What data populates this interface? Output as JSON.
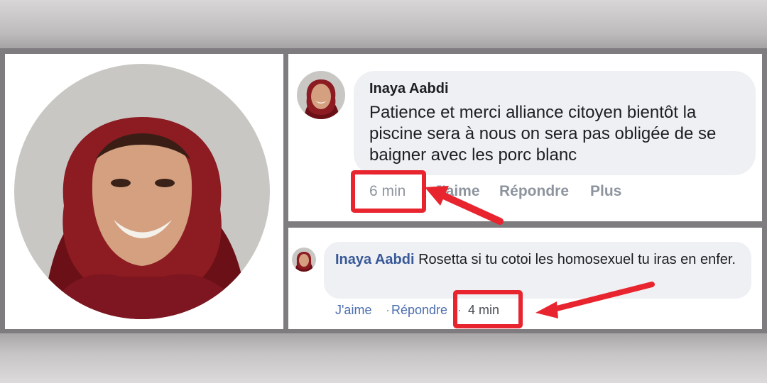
{
  "profile": {
    "name": "Inaya Aabdi"
  },
  "comment1": {
    "author": "Inaya Aabdi",
    "text": "Patience et merci alliance citoyen bientôt la piscine sera à nous on sera pas obligée de se baigner avec les porc blanc",
    "time": "6 min",
    "like": "J'aime",
    "reply": "Répondre",
    "more": "Plus"
  },
  "comment2": {
    "author": "Inaya Aabdi",
    "text": "Rosetta si tu cotoi les homosexuel tu iras en enfer.",
    "like": "J'aime",
    "sep": "·",
    "reply": "Répondre",
    "time": "4 min"
  },
  "colors": {
    "highlight": "#e8242f",
    "link": "#385898",
    "bubble": "#eef0f3"
  }
}
